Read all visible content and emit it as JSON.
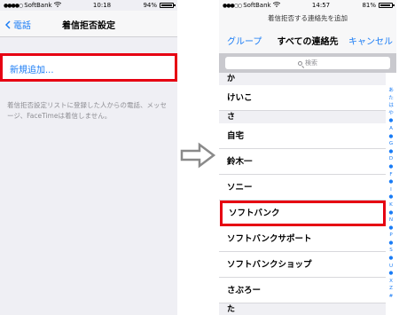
{
  "left": {
    "status": {
      "carrier": "SoftBank",
      "time": "10:18",
      "battery": "94%",
      "battery_level": 0.94
    },
    "nav": {
      "back_label": "電話",
      "title": "着信拒否設定"
    },
    "add_new_label": "新規追加...",
    "description": "着信拒否設定リストに登録した人からの電話、メッセージ、FaceTimeは着信しません。"
  },
  "right": {
    "status": {
      "carrier": "SoftBank",
      "time": "14:57",
      "battery": "81%",
      "battery_level": 0.81
    },
    "subtitle": "着信拒否する連絡先を追加",
    "nav": {
      "groups_label": "グループ",
      "title": "すべての連絡先",
      "cancel_label": "キャンセル"
    },
    "search": {
      "placeholder": "検索"
    },
    "list": [
      {
        "type": "section",
        "label": "か"
      },
      {
        "type": "contact",
        "label": "けいこ"
      },
      {
        "type": "section",
        "label": "さ"
      },
      {
        "type": "contact",
        "label": "自宅"
      },
      {
        "type": "contact",
        "label": "鈴木一"
      },
      {
        "type": "contact",
        "label": "ソニー"
      },
      {
        "type": "contact",
        "label": "ソフトバンク",
        "highlighted": true
      },
      {
        "type": "contact",
        "label": "ソフトバンクサポート"
      },
      {
        "type": "contact",
        "label": "ソフトバンクショップ"
      },
      {
        "type": "contact",
        "label": "さぶろー"
      },
      {
        "type": "section",
        "label": "た"
      }
    ],
    "index": [
      "あ",
      "た",
      "は",
      "や",
      "●",
      "A",
      "●",
      "G",
      "●",
      "D",
      "●",
      "F",
      "●",
      "I",
      "●",
      "K",
      "●",
      "N",
      "●",
      "P",
      "●",
      "S",
      "●",
      "U",
      "●",
      "X",
      "Z",
      "#"
    ]
  },
  "colors": {
    "accent": "#1a7cf5",
    "highlight": "#e60012"
  },
  "icons": {
    "arrow": "right-arrow-icon",
    "back": "chevron-left-icon",
    "search": "search-icon",
    "wifi": "wifi-icon",
    "battery": "battery-icon"
  }
}
